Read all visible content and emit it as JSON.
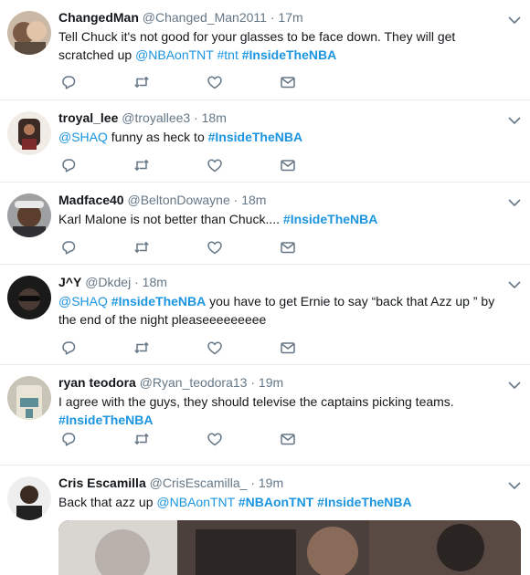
{
  "tweets": [
    {
      "name": "ChangedMan",
      "handle": "@Changed_Man2011",
      "time": "17m",
      "segments": [
        {
          "t": "text",
          "v": "Tell Chuck it's not good for your glasses to be face down. They will get scratched up "
        },
        {
          "t": "mention",
          "v": "@NBAonTNT"
        },
        {
          "t": "text",
          "v": " "
        },
        {
          "t": "link",
          "v": "#tnt"
        },
        {
          "t": "text",
          "v": " "
        },
        {
          "t": "tag",
          "v": "#InsideTheNBA"
        }
      ]
    },
    {
      "name": "troyal_lee",
      "handle": "@troyallee3",
      "time": "18m",
      "segments": [
        {
          "t": "mention",
          "v": "@SHAQ"
        },
        {
          "t": "text",
          "v": " funny as heck to "
        },
        {
          "t": "tag",
          "v": "#InsideTheNBA"
        }
      ]
    },
    {
      "name": "Madface40",
      "handle": "@BeltonDowayne",
      "time": "18m",
      "segments": [
        {
          "t": "text",
          "v": "Karl Malone is not better than Chuck.... "
        },
        {
          "t": "tag",
          "v": "#InsideTheNBA"
        }
      ]
    },
    {
      "name": "J^Y",
      "handle": "@Dkdej",
      "time": "18m",
      "segments": [
        {
          "t": "mention",
          "v": "@SHAQ"
        },
        {
          "t": "text",
          "v": " "
        },
        {
          "t": "tag",
          "v": "#InsideTheNBA"
        },
        {
          "t": "text",
          "v": "  you have to get Ernie to say “back that Azz up ” by the end of the night pleaseeeeeeeee"
        }
      ]
    },
    {
      "name": "ryan teodora",
      "handle": "@Ryan_teodora13",
      "time": "19m",
      "segments": [
        {
          "t": "text",
          "v": "I agree with the guys, they should televise the captains picking teams. "
        },
        {
          "t": "tag",
          "v": "#InsideTheNBA"
        }
      ]
    },
    {
      "name": "Cris Escamilla",
      "handle": "@CrisEscamilla_",
      "time": "19m",
      "segments": [
        {
          "t": "text",
          "v": "Back that azz up "
        },
        {
          "t": "mention",
          "v": "@NBAonTNT"
        },
        {
          "t": "text",
          "v": " "
        },
        {
          "t": "tag",
          "v": "#NBAonTNT"
        },
        {
          "t": "text",
          "v": " "
        },
        {
          "t": "tag",
          "v": "#InsideTheNBA"
        }
      ]
    }
  ],
  "separator": "·",
  "icons": {
    "reply": "reply-icon",
    "retweet": "retweet-icon",
    "like": "heart-icon",
    "dm": "envelope-icon",
    "menu": "chevron-down-icon"
  },
  "colors": {
    "link": "#1b95e0",
    "muted": "#657786",
    "text": "#14171a",
    "divider": "#e6ecf0"
  }
}
